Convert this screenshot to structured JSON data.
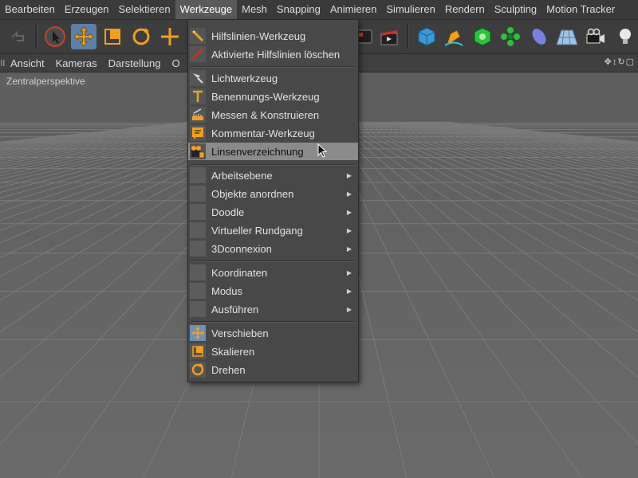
{
  "menubar": {
    "items": [
      "Bearbeiten",
      "Erzeugen",
      "Selektieren",
      "Werkzeuge",
      "Mesh",
      "Snapping",
      "Animieren",
      "Simulieren",
      "Rendern",
      "Sculpting",
      "Motion Tracker"
    ],
    "active_index": 3
  },
  "viewbar": {
    "items": [
      "Ansicht",
      "Kameras",
      "Darstellung",
      "O"
    ]
  },
  "viewport": {
    "label": "Zentralperspektive"
  },
  "menu": {
    "items": [
      {
        "label": "Hilfslinien-Werkzeug",
        "icon": "guide-tool-icon"
      },
      {
        "label": "Aktivierte Hilfslinien löschen",
        "icon": "delete-guides-icon"
      },
      {
        "label": "Lichtwerkzeug",
        "icon": "light-tool-icon"
      },
      {
        "label": "Benennungs-Werkzeug",
        "icon": "naming-tool-icon"
      },
      {
        "label": "Messen & Konstruieren",
        "icon": "measure-icon"
      },
      {
        "label": "Kommentar-Werkzeug",
        "icon": "annotation-icon"
      },
      {
        "label": "Linsenverzeichnung",
        "icon": "lens-distortion-icon"
      },
      {
        "label": "Arbeitsebene",
        "submenu": true
      },
      {
        "label": "Objekte anordnen",
        "submenu": true
      },
      {
        "label": "Doodle",
        "submenu": true
      },
      {
        "label": "Virtueller Rundgang",
        "submenu": true
      },
      {
        "label": "3Dconnexion",
        "submenu": true
      },
      {
        "label": "Koordinaten",
        "submenu": true
      },
      {
        "label": "Modus",
        "submenu": true
      },
      {
        "label": "Ausführen",
        "submenu": true
      },
      {
        "label": "Verschieben",
        "icon": "move-icon"
      },
      {
        "label": "Skalieren",
        "icon": "scale-icon"
      },
      {
        "label": "Drehen",
        "icon": "rotate-icon"
      }
    ],
    "hover_label": "Linsenverzeichnung"
  },
  "colors": {
    "accent_orange": "#f0a020",
    "selection_blue": "#5d7fa8",
    "menu_bg": "#484848",
    "hover_bg": "#8a8a8a"
  }
}
